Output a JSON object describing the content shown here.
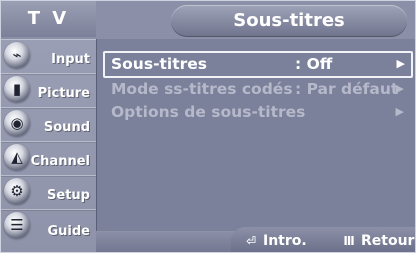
{
  "header": {
    "tv_label": "T V",
    "title": "Sous-titres"
  },
  "sidebar": {
    "items": [
      {
        "label": "Input",
        "icon": "input-icon",
        "glyph": "⌁"
      },
      {
        "label": "Picture",
        "icon": "picture-icon",
        "glyph": "▮"
      },
      {
        "label": "Sound",
        "icon": "sound-icon",
        "glyph": "◉"
      },
      {
        "label": "Channel",
        "icon": "channel-icon",
        "glyph": "◭"
      },
      {
        "label": "Setup",
        "icon": "setup-icon",
        "glyph": "⚙"
      },
      {
        "label": "Guide",
        "icon": "guide-icon",
        "glyph": "☰"
      }
    ]
  },
  "menu": {
    "rows": [
      {
        "label": "Sous-titres",
        "value": ": Off",
        "arrow": "▶",
        "state": "selected"
      },
      {
        "label": "Mode ss-titres codés",
        "value": ": Par défaut",
        "arrow": "▶",
        "state": "disabled"
      },
      {
        "label": "Options de sous-titres",
        "value": "",
        "arrow": "▶",
        "state": "disabled"
      }
    ]
  },
  "footer": {
    "enter_label": "Intro.",
    "enter_glyph": "⏎",
    "return_label": "Retour",
    "return_glyph": "Ⅲ"
  },
  "colors": {
    "panel": "#7b809b",
    "header": "#8b8fa7",
    "text": "#ffffff",
    "disabled_text": "#b5b9ca"
  }
}
